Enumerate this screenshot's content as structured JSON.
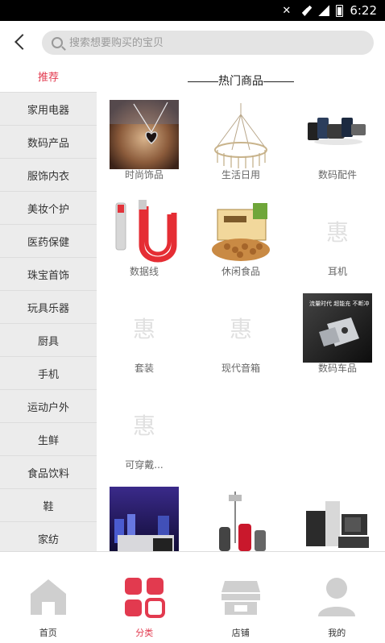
{
  "status_bar": {
    "time": "6:22"
  },
  "header": {
    "back_icon": "chevron-left-icon",
    "search_placeholder": "搜索想要购买的宝贝"
  },
  "sidebar": {
    "items": [
      {
        "label": "推荐",
        "active": true
      },
      {
        "label": "家用电器"
      },
      {
        "label": "数码产品"
      },
      {
        "label": "服饰内衣"
      },
      {
        "label": "美妆个护"
      },
      {
        "label": "医药保健"
      },
      {
        "label": "珠宝首饰"
      },
      {
        "label": "玩具乐器"
      },
      {
        "label": "厨具"
      },
      {
        "label": "手机"
      },
      {
        "label": "运动户外"
      },
      {
        "label": "生鲜"
      },
      {
        "label": "食品饮料"
      },
      {
        "label": "鞋"
      },
      {
        "label": "家纺"
      }
    ]
  },
  "main": {
    "section_title": "热门商品",
    "products": [
      {
        "label": "时尚饰品",
        "image": "necklace-photo"
      },
      {
        "label": "生活日用",
        "image": "drying-rack-photo"
      },
      {
        "label": "数码配件",
        "image": "phone-accessories-photo"
      },
      {
        "label": "数据线",
        "image": "cable-photo"
      },
      {
        "label": "休闲食品",
        "image": "snack-box-photo"
      },
      {
        "label": "耳机",
        "image": "placeholder"
      },
      {
        "label": "套装",
        "image": "placeholder"
      },
      {
        "label": "现代音箱",
        "image": "placeholder"
      },
      {
        "label": "数码车品",
        "image": "car-charger-photo",
        "image_text": "流量时代 超能充 不断冲"
      },
      {
        "label": "可穿戴...",
        "image": "placeholder"
      },
      {
        "label": "",
        "image": "kitchen-appliance-photo"
      },
      {
        "label": "",
        "image": "garment-steamer-photo"
      },
      {
        "label": "",
        "image": "home-appliances-photo"
      }
    ],
    "placeholder_glyph": "惠"
  },
  "tabbar": {
    "tabs": [
      {
        "label": "首页",
        "icon": "home-icon"
      },
      {
        "label": "分类",
        "icon": "category-grid-icon",
        "active": true
      },
      {
        "label": "店铺",
        "icon": "shop-icon"
      },
      {
        "label": "我的",
        "icon": "user-icon"
      }
    ]
  },
  "colors": {
    "accent": "#e23a4f",
    "sidebar_bg": "#ececec",
    "icon_inactive": "#cfcfcf"
  }
}
